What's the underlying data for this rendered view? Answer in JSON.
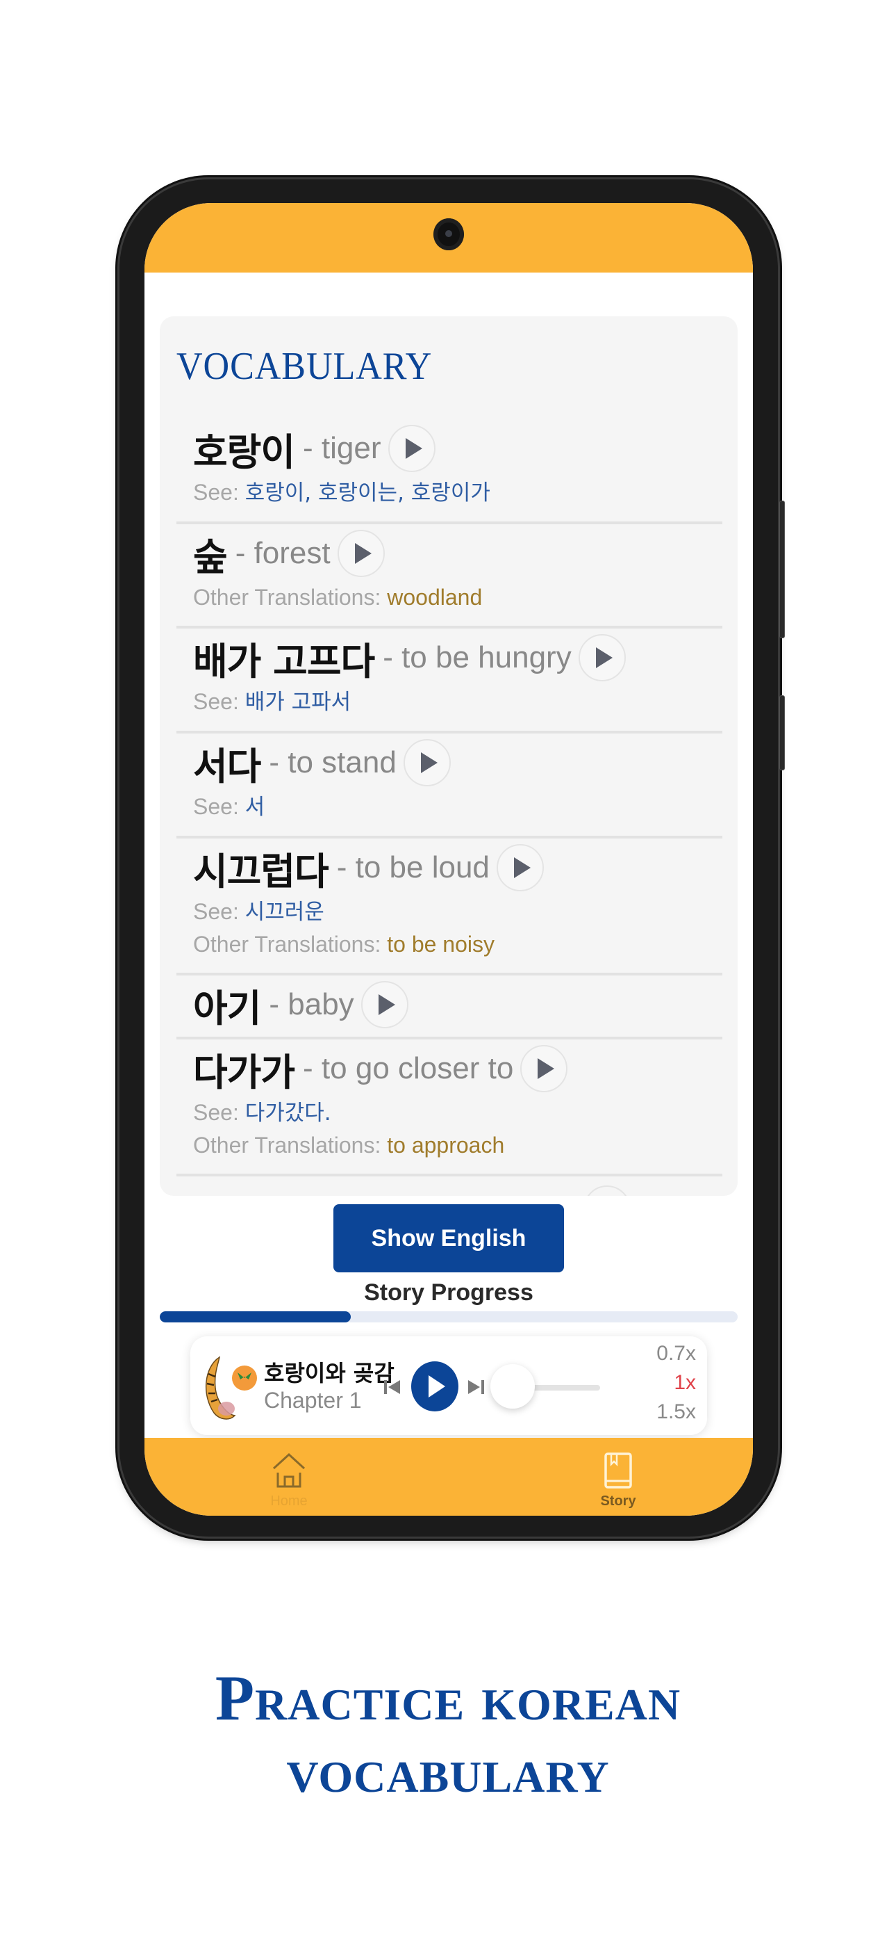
{
  "colors": {
    "brand_blue": "#0c4597",
    "accent_yellow": "#fbb336",
    "see_link": "#2f5da3",
    "other_translation": "#a07c2c",
    "active_speed": "#e0434b"
  },
  "vocabulary": {
    "title": "VOCABULARY",
    "see_label": "See: ",
    "other_label": "Other Translations: ",
    "entries": [
      {
        "korean": "호랑이",
        "english": "- tiger",
        "see": "호랑이, 호랑이는, 호랑이가",
        "other": null
      },
      {
        "korean": "숲",
        "english": "- forest",
        "see": null,
        "other": "woodland"
      },
      {
        "korean": "배가 고프다",
        "english": "- to be hungry",
        "see": "배가 고파서",
        "other": null
      },
      {
        "korean": "서다",
        "english": "- to stand",
        "see": "서",
        "other": null
      },
      {
        "korean": "시끄럽다",
        "english": "- to be loud",
        "see": "시끄러운",
        "other": "to be noisy"
      },
      {
        "korean": "아기",
        "english": "- baby",
        "see": null,
        "other": null
      },
      {
        "korean": "다가가",
        "english": "- to go closer to",
        "see": "다가갔다.",
        "other": "to approach"
      }
    ]
  },
  "actions": {
    "show_english": "Show English"
  },
  "progress": {
    "label": "Story Progress",
    "value": 0.33
  },
  "player": {
    "story_title": "호랑이와 곶감",
    "chapter": "Chapter 1",
    "cover_icon": "tiger-persimmon-illustration",
    "position": 0.0,
    "speeds": [
      "0.7x",
      "1x",
      "1.5x"
    ],
    "selected_speed": "1x"
  },
  "nav": {
    "items": [
      {
        "label": "Home",
        "icon": "home-icon",
        "active": false
      },
      {
        "label": "Story",
        "icon": "book-icon",
        "active": true
      }
    ]
  },
  "headline": {
    "line1": "Practice korean",
    "line2": "vocabulary"
  }
}
